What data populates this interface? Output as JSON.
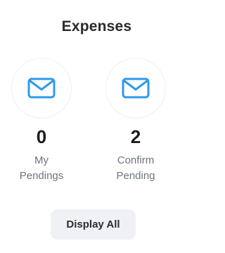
{
  "card": {
    "title": "Expenses",
    "accent_color": "#2e9be8",
    "stats": [
      {
        "count": "0",
        "label_line1": "My",
        "label_line2": "Pendings",
        "icon": "mail-icon"
      },
      {
        "count": "2",
        "label_line1": "Confirm",
        "label_line2": "Pending",
        "icon": "mail-icon"
      }
    ],
    "display_all_label": "Display All"
  }
}
